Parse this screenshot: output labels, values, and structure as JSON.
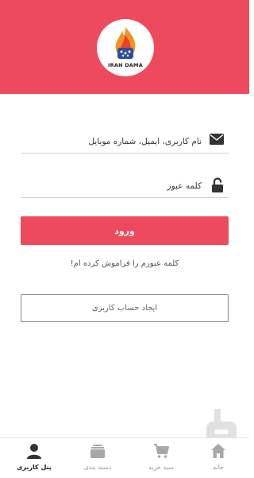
{
  "brand": {
    "logo_text": "IRAN DAMA",
    "accent_color": "#ee4a5e"
  },
  "login_form": {
    "username_placeholder": "نام کاربری، ایمیل، شماره موبایل",
    "username_icon": "envelope-icon",
    "password_placeholder": "کلمه عبور",
    "password_icon": "lock-icon",
    "login_label": "ورود",
    "forgot_label": "کلمه عبورم را فراموش کرده ام!",
    "register_label": "ایجاد حساب کاربری"
  },
  "bottom_nav": {
    "items": [
      {
        "label": "پنل کاربری",
        "icon": "user-icon",
        "active": true
      },
      {
        "label": "دسته بندی",
        "icon": "category-icon",
        "active": false
      },
      {
        "label": "سبد خرید",
        "icon": "cart-icon",
        "active": false
      },
      {
        "label": "خانه",
        "icon": "home-icon",
        "active": false
      }
    ]
  }
}
